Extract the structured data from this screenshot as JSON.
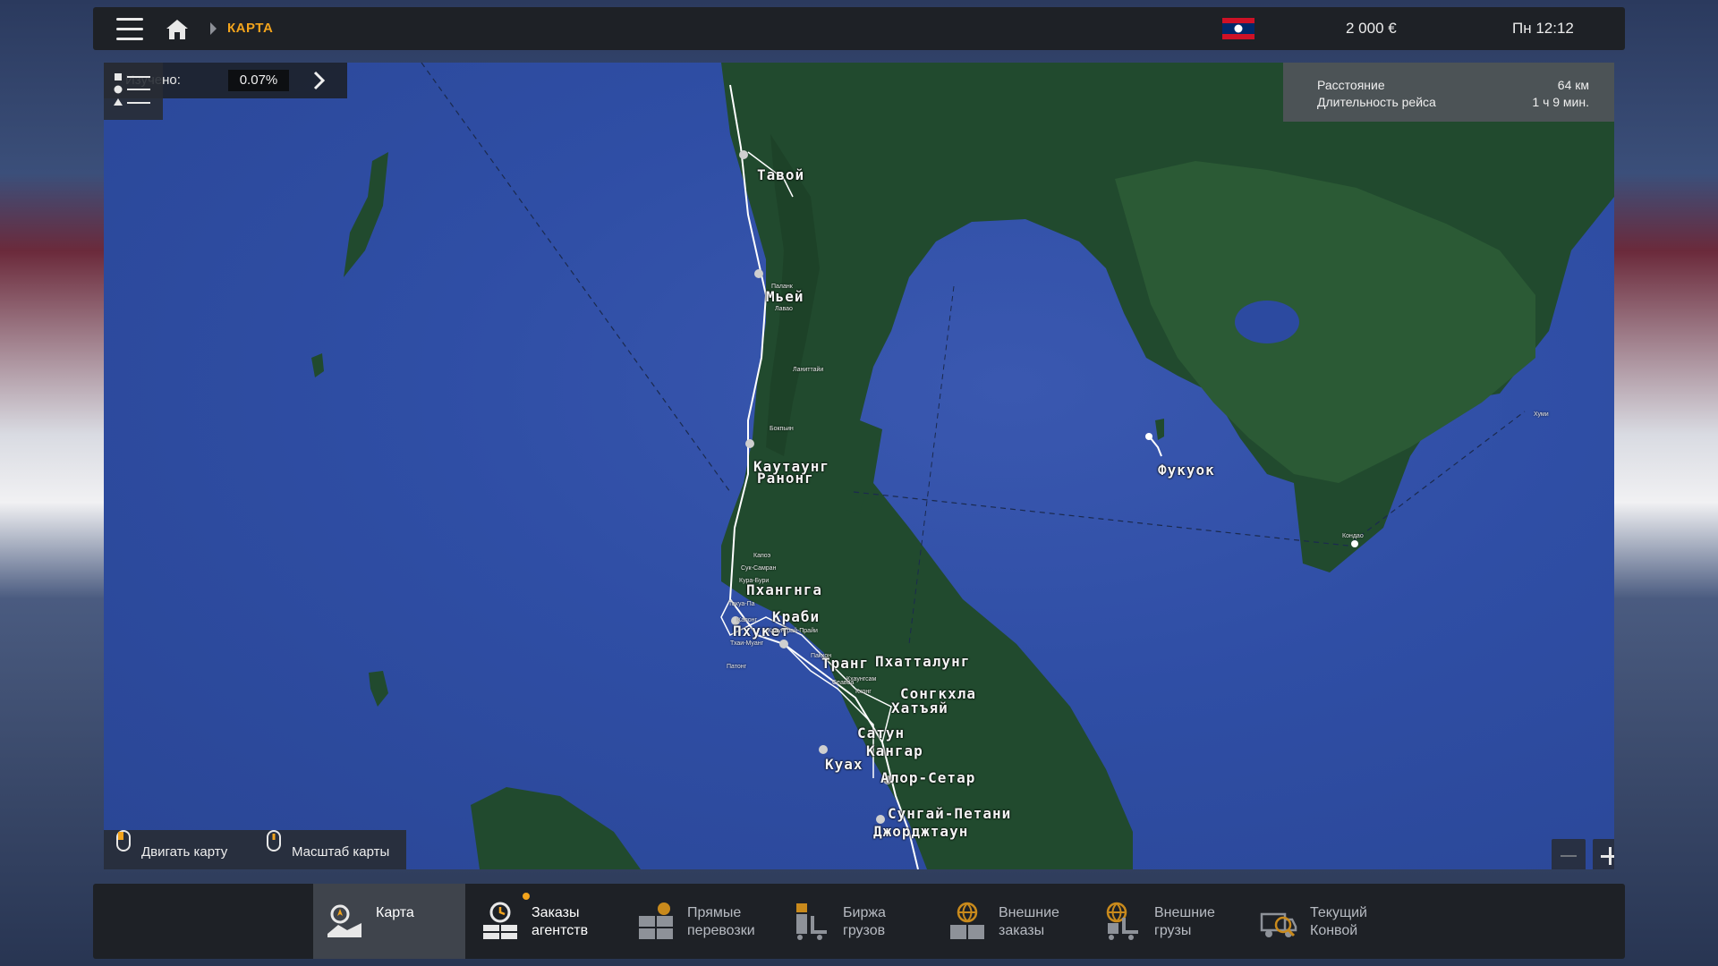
{
  "header": {
    "breadcrumb": "КАРТА",
    "money": "2 000 €",
    "datetime": "Пн 12:12",
    "accent_color": "#f3a41c"
  },
  "map": {
    "explored_label": "Изучено:",
    "explored_value": "0.07%",
    "route": {
      "distance_label": "Расстояние",
      "distance_value": "64 км",
      "duration_label": "Длительность рейса",
      "duration_value": "1 ч 9 мин."
    },
    "hints": {
      "move": "Двигать карту",
      "zoom": "Масштаб карты"
    },
    "cities": [
      "Тавой",
      "Мьей",
      "Каутаунг",
      "Ранонг",
      "Пхангнга",
      "Краби",
      "Пхукет",
      "Транг",
      "Пхатталунг",
      "Сонгкхла",
      "Хатъяй",
      "Сатун",
      "Кангар",
      "Куах",
      "Алор-Сетар",
      "Сунгай-Петани",
      "Джорджтаун",
      "Фукуок"
    ],
    "towns": [
      "Паланк",
      "Лавао",
      "Ланиттайи",
      "Бокпьин",
      "Капоэ",
      "Сук-Самран",
      "Кура-Бури",
      "Такуа-Па",
      "Капонг",
      "Кхаунграй-Прайи",
      "Тхаи-Муанг",
      "Патонг",
      "Пакхон",
      "Кхаунгсам",
      "Кхонг",
      "Сеавоа",
      "Кондао",
      "Хуми"
    ]
  },
  "tabs": [
    {
      "label": "Карта",
      "icon": "map-icon"
    },
    {
      "label": "Заказы агентств",
      "icon": "agency-clock-icon"
    },
    {
      "label": "Прямые перевозки",
      "icon": "direct-cargo-icon"
    },
    {
      "label": "Биржа грузов",
      "icon": "freight-market-icon"
    },
    {
      "label": "Внешние заказы",
      "icon": "external-orders-icon"
    },
    {
      "label": "Внешние грузы",
      "icon": "external-cargo-icon"
    },
    {
      "label": "Текущий Конвой",
      "icon": "convoy-icon"
    }
  ]
}
